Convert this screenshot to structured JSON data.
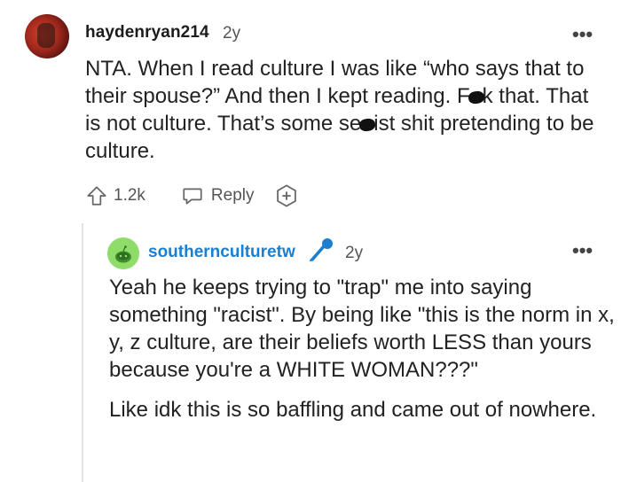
{
  "comment": {
    "username": "haydenryan214",
    "age": "2y",
    "more_label": "•••",
    "text_part1": "NTA. When I read culture I was like “who says that to their spouse?” And then I kept reading. F",
    "text_part2": "k that. That is not culture. That’s some se",
    "text_part3": "ist shit pretending to be culture.",
    "upvotes": "1.2k",
    "reply_label": "Reply"
  },
  "reply": {
    "username": "southernculturetw",
    "age": "2y",
    "more_label": "•••",
    "paragraph1": "Yeah he keeps trying to \"trap\" me into saying something \"racist\". By being like \"this is the norm in x, y, z culture, are their beliefs worth LESS than yours because you're a WHITE WOMAN???\"",
    "paragraph2": "Like idk this is so baffling and came out of nowhere."
  },
  "colors": {
    "username_reply": "#1b7fd1",
    "avatar_reply": "#8fdc6a",
    "mic_icon": "#1b7fd1",
    "thread_line": "#e2e2e2"
  },
  "icons": [
    "upvote-icon",
    "reply-icon",
    "award-icon",
    "mic-icon",
    "more-options-icon"
  ]
}
